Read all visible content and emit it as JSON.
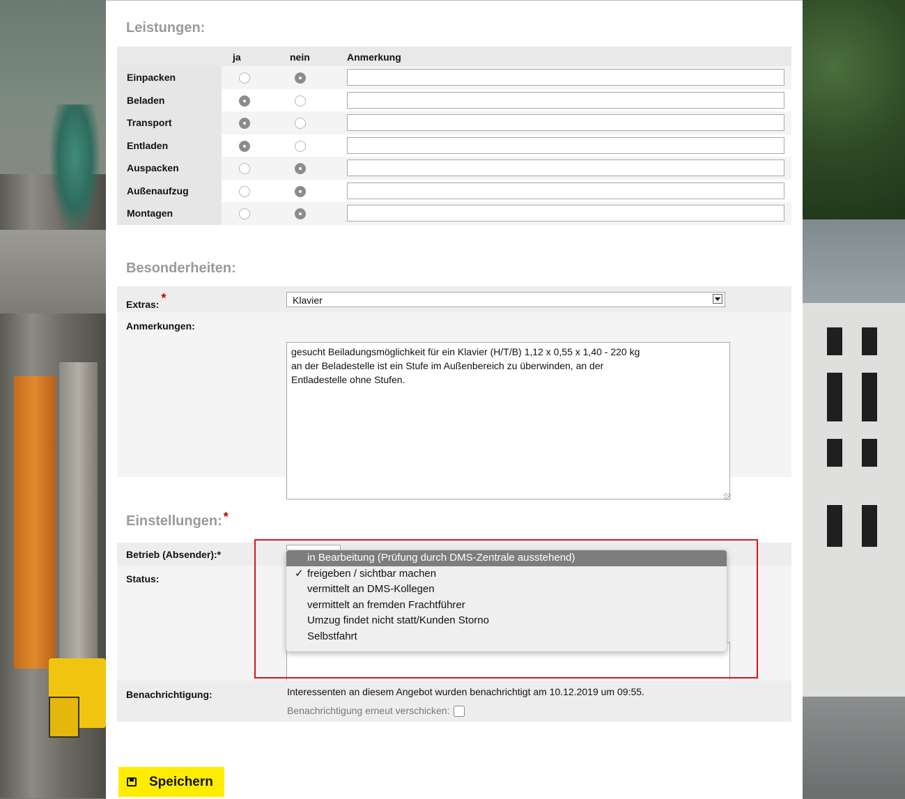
{
  "leistungen": {
    "title": "Leistungen:",
    "col_ja": "ja",
    "col_nein": "nein",
    "col_anmerkung": "Anmerkung",
    "rows": [
      {
        "label": "Einpacken",
        "selected": "nein",
        "anmerkung": ""
      },
      {
        "label": "Beladen",
        "selected": "ja",
        "anmerkung": ""
      },
      {
        "label": "Transport",
        "selected": "ja",
        "anmerkung": ""
      },
      {
        "label": "Entladen",
        "selected": "ja",
        "anmerkung": ""
      },
      {
        "label": "Auspacken",
        "selected": "nein",
        "anmerkung": ""
      },
      {
        "label": "Außenaufzug",
        "selected": "nein",
        "anmerkung": ""
      },
      {
        "label": "Montagen",
        "selected": "nein",
        "anmerkung": ""
      }
    ]
  },
  "besonderheiten": {
    "title": "Besonderheiten:",
    "extras_label": "Extras:",
    "required_mark": "*",
    "extras_value": "Klavier",
    "anmerkungen_label": "Anmerkungen:",
    "anmerkungen_text": "gesucht Beiladungsmöglichkeit für ein Klavier (H/T/B) 1,12 x 0,55 x 1,40 - 220 kg\nan der Beladestelle ist ein Stufe im Außenbereich zu überwinden, an der\nEntladestelle ohne Stufen."
  },
  "einstellungen": {
    "title": "Einstellungen:",
    "required_mark": "*",
    "betrieb_label": "Betrieb (Absender):*",
    "status_label": "Status:",
    "status_options": [
      {
        "label": "in Bearbeitung (Prüfung durch DMS-Zentrale ausstehend)",
        "highlighted": true,
        "checked": false
      },
      {
        "label": "freigeben / sichtbar machen",
        "highlighted": false,
        "checked": true
      },
      {
        "label": "vermittelt an DMS-Kollegen",
        "highlighted": false,
        "checked": false
      },
      {
        "label": "vermittelt an fremden Frachtführer",
        "highlighted": false,
        "checked": false
      },
      {
        "label": "Umzug findet nicht statt/Kunden Storno",
        "highlighted": false,
        "checked": false
      },
      {
        "label": "Selbstfahrt",
        "highlighted": false,
        "checked": false
      }
    ],
    "benachrichtigung_label": "Benachrichtigung:",
    "benachrichtigung_text": "Interessenten an diesem Angebot wurden benachrichtigt am 10.12.2019 um 09:55.",
    "resend_label": "Benachrichtigung erneut verschicken:"
  },
  "save_button": {
    "label": "Speichern",
    "icon": "floppy-disk-icon",
    "color": "#ffed00"
  },
  "colors": {
    "section_title": "#9a9a9a",
    "highlight_box": "#d0161f",
    "required": "#cc0000"
  }
}
